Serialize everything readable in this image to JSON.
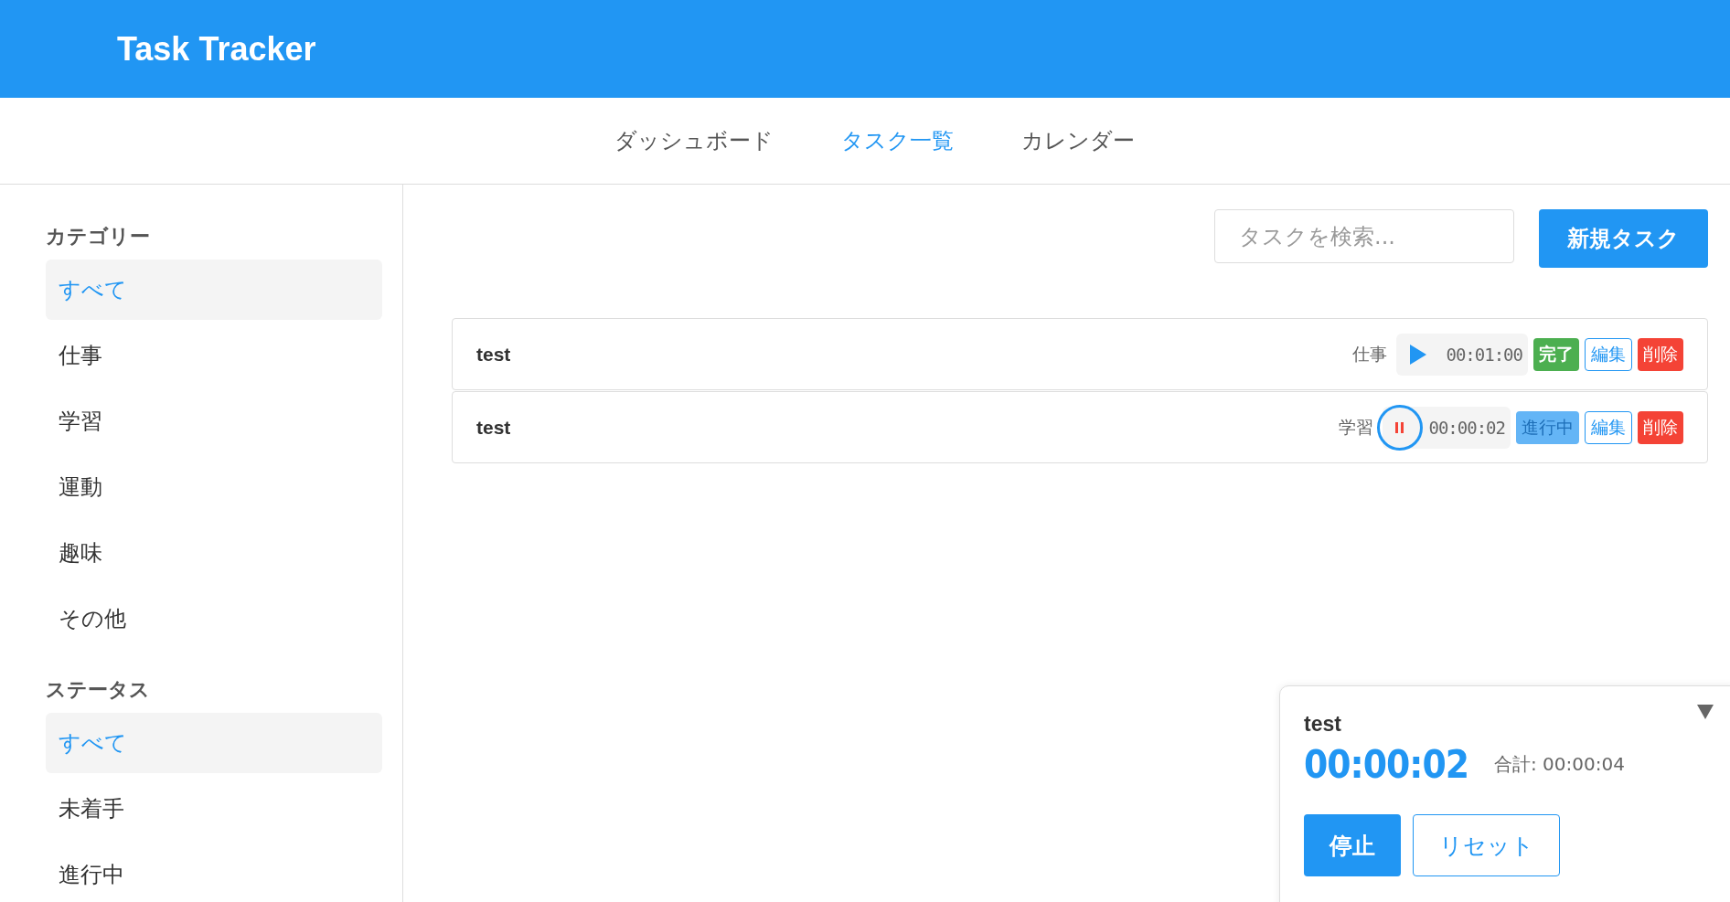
{
  "header": {
    "title": "Task Tracker"
  },
  "nav": [
    {
      "label": "ダッシュボード",
      "selected": false
    },
    {
      "label": "タスク一覧",
      "selected": true
    },
    {
      "label": "カレンダー",
      "selected": false
    }
  ],
  "sidebar": [
    {
      "heading": "カテゴリー",
      "items": [
        {
          "label": "すべて",
          "selected": true
        },
        {
          "label": "仕事",
          "selected": false
        },
        {
          "label": "学習",
          "selected": false
        },
        {
          "label": "運動",
          "selected": false
        },
        {
          "label": "趣味",
          "selected": false
        },
        {
          "label": "その他",
          "selected": false
        }
      ]
    },
    {
      "heading": "ステータス",
      "items": [
        {
          "label": "すべて",
          "selected": true
        },
        {
          "label": "未着手",
          "selected": false
        },
        {
          "label": "進行中",
          "selected": false
        }
      ]
    }
  ],
  "search": {
    "placeholder": "タスクを検索..."
  },
  "new_task_button": "新規タスク",
  "tasks": [
    {
      "title": "test",
      "category": "仕事",
      "running": false,
      "time": "00:01:00",
      "status": {
        "kind": "done",
        "label": "完了"
      },
      "edit": "編集",
      "delete": "削除"
    },
    {
      "title": "test",
      "category": "学習",
      "running": true,
      "time": "00:00:02",
      "status": {
        "kind": "in_progress",
        "label": "進行中"
      },
      "edit": "編集",
      "delete": "削除"
    }
  ],
  "timer_panel": {
    "task": "test",
    "elapsed": "00:00:02",
    "total": "合計: 00:00:04",
    "stop": "停止",
    "reset": "リセット"
  }
}
